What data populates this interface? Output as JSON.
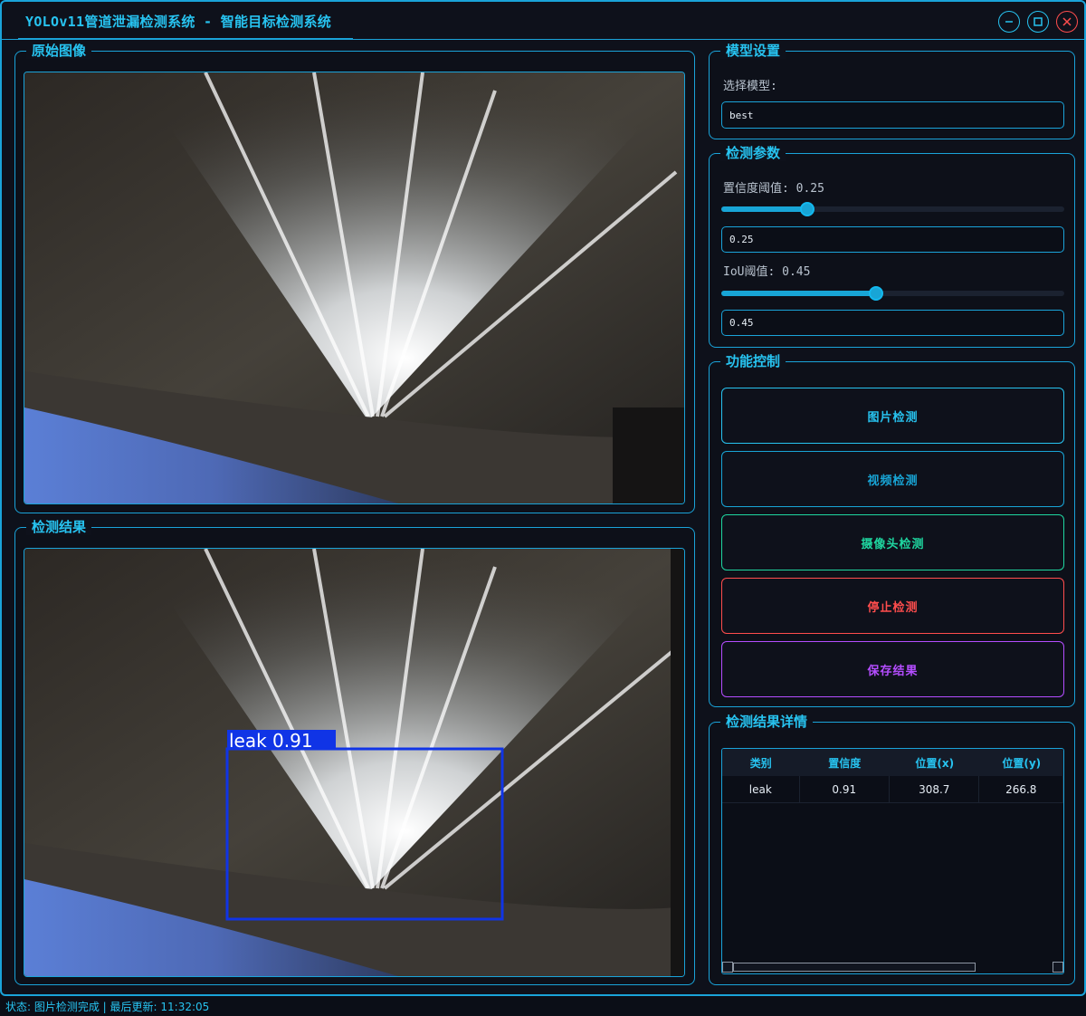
{
  "window": {
    "title": "YOLOv11管道泄漏检测系统 - 智能目标检测系统"
  },
  "original_panel": {
    "title": "原始图像"
  },
  "result_panel": {
    "title": "检测结果",
    "detection_label": "leak 0.91",
    "detection_color": "#1034e6"
  },
  "model_settings": {
    "title": "模型设置",
    "select_label": "选择模型:",
    "model_value": "best"
  },
  "detection_params": {
    "title": "检测参数",
    "confidence_label": "置信度阈值: 0.25",
    "confidence_value": "0.25",
    "confidence_fraction": 0.25,
    "iou_label": "IoU阈值: 0.45",
    "iou_value": "0.45",
    "iou_fraction": 0.45
  },
  "function_control": {
    "title": "功能控制",
    "buttons": [
      {
        "label": "图片检测",
        "color": "#27c3f0"
      },
      {
        "label": "视频检测",
        "color": "#18a5d6"
      },
      {
        "label": "摄像头检测",
        "color": "#1fd6a0"
      },
      {
        "label": "停止检测",
        "color": "#ff4d4d"
      },
      {
        "label": "保存结果",
        "color": "#b44dff"
      }
    ]
  },
  "details": {
    "title": "检测结果详情",
    "columns": [
      "类别",
      "置信度",
      "位置(x)",
      "位置(y)"
    ],
    "rows": [
      [
        "leak",
        "0.91",
        "308.7",
        "266.8"
      ]
    ]
  },
  "status": {
    "text": "状态: 图片检测完成 | 最后更新: 11:32:05"
  },
  "icons": {
    "minimize": "minimize-icon",
    "maximize": "maximize-icon",
    "close": "close-icon"
  }
}
